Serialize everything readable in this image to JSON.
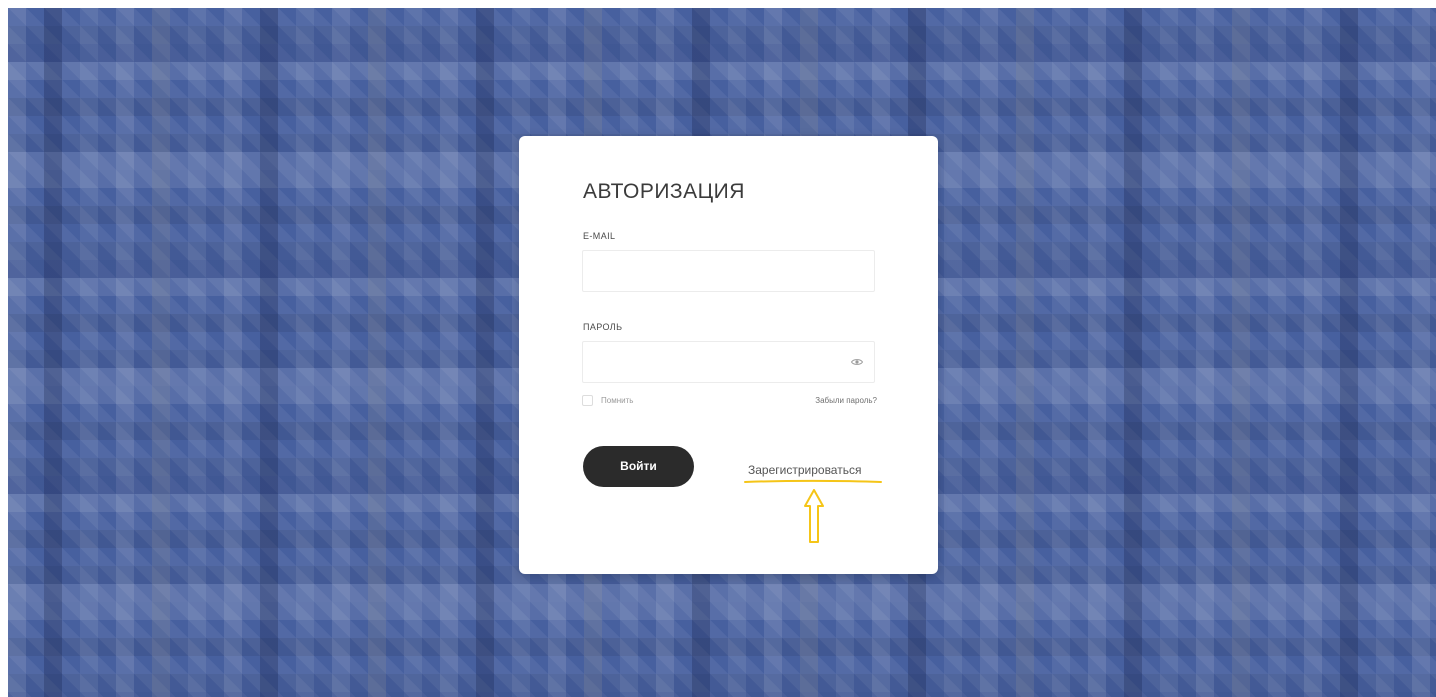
{
  "login": {
    "title": "АВТОРИЗАЦИЯ",
    "email_label": "E-MAIL",
    "email_value": "",
    "password_label": "ПАРОЛЬ",
    "password_value": "",
    "password_toggle_icon": "eye-icon",
    "remember_label": "Помнить",
    "remember_checked": false,
    "forgot_link": "Забыли пароль?",
    "submit_label": "Войти",
    "register_link": "Зарегистрироваться"
  },
  "annotation": {
    "color": "#f5c518",
    "marks": [
      "underline",
      "up-arrow"
    ]
  },
  "colors": {
    "background": "#47609f",
    "card": "#ffffff",
    "button": "#2b2b2b"
  }
}
